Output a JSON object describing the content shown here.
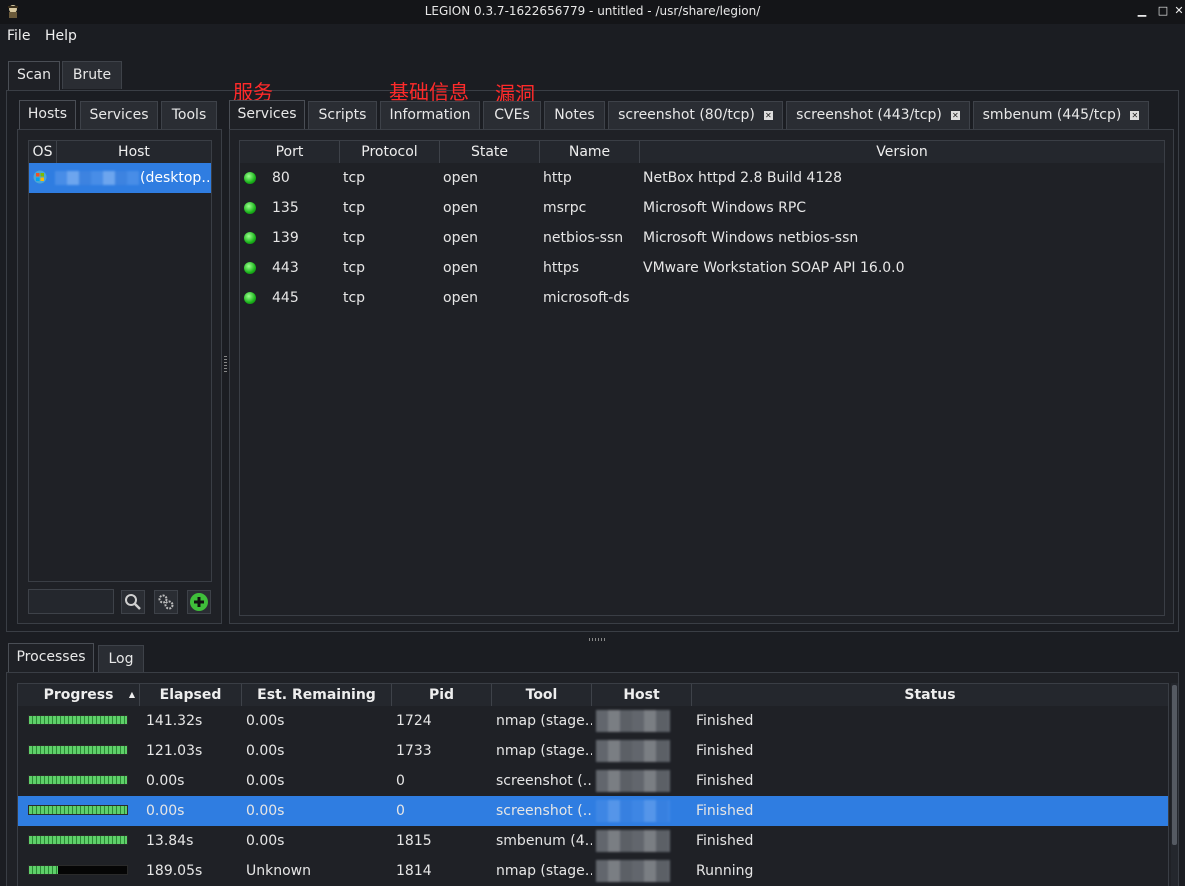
{
  "window": {
    "title": "LEGION 0.3.7-1622656779 - untitled - /usr/share/legion/"
  },
  "menu": [
    "File",
    "Help"
  ],
  "main_tabs": [
    {
      "label": "Scan",
      "active": true
    },
    {
      "label": "Brute",
      "active": false
    }
  ],
  "left_tabs": [
    {
      "label": "Hosts",
      "active": true
    },
    {
      "label": "Services",
      "active": false
    },
    {
      "label": "Tools",
      "active": false
    }
  ],
  "hosts": {
    "columns": [
      "OS",
      "Host"
    ],
    "rows": [
      {
        "os_icon": "windows-os-icon",
        "host": "(desktop…",
        "selected": true
      }
    ],
    "filter_placeholder": "",
    "buttons": {
      "search": "search-icon",
      "settings": "settings-icon",
      "add": "add-icon"
    }
  },
  "annotations": {
    "services": "服务",
    "information": "基础信息",
    "cves": "漏洞"
  },
  "right_tabs": [
    {
      "label": "Services",
      "active": true,
      "closable": false
    },
    {
      "label": "Scripts",
      "active": false,
      "closable": false
    },
    {
      "label": "Information",
      "active": false,
      "closable": false
    },
    {
      "label": "CVEs",
      "active": false,
      "closable": false
    },
    {
      "label": "Notes",
      "active": false,
      "closable": false
    },
    {
      "label": "screenshot (80/tcp)",
      "active": false,
      "closable": true
    },
    {
      "label": "screenshot (443/tcp)",
      "active": false,
      "closable": true
    },
    {
      "label": "smbenum (445/tcp)",
      "active": false,
      "closable": true
    }
  ],
  "services": {
    "columns": [
      "Port",
      "Protocol",
      "State",
      "Name",
      "Version"
    ],
    "rows": [
      {
        "port": "80",
        "protocol": "tcp",
        "state": "open",
        "name": "http",
        "version": "NetBox httpd 2.8 Build 4128"
      },
      {
        "port": "135",
        "protocol": "tcp",
        "state": "open",
        "name": "msrpc",
        "version": "Microsoft Windows RPC"
      },
      {
        "port": "139",
        "protocol": "tcp",
        "state": "open",
        "name": "netbios-ssn",
        "version": "Microsoft Windows netbios-ssn"
      },
      {
        "port": "443",
        "protocol": "tcp",
        "state": "open",
        "name": "https",
        "version": "VMware Workstation SOAP API 16.0.0"
      },
      {
        "port": "445",
        "protocol": "tcp",
        "state": "open",
        "name": "microsoft-ds",
        "version": ""
      }
    ]
  },
  "bottom_tabs": [
    {
      "label": "Processes",
      "active": true
    },
    {
      "label": "Log",
      "active": false
    }
  ],
  "processes": {
    "columns": [
      "Progress",
      "Elapsed",
      "Est. Remaining",
      "Pid",
      "Tool",
      "Host",
      "Status"
    ],
    "sort_indicator": "▲",
    "rows": [
      {
        "progress": 1.0,
        "elapsed": "141.32s",
        "remaining": "0.00s",
        "pid": "1724",
        "tool": "nmap (stage…",
        "status": "Finished",
        "selected": false
      },
      {
        "progress": 1.0,
        "elapsed": "121.03s",
        "remaining": "0.00s",
        "pid": "1733",
        "tool": "nmap (stage…",
        "status": "Finished",
        "selected": false
      },
      {
        "progress": 1.0,
        "elapsed": "0.00s",
        "remaining": "0.00s",
        "pid": "0",
        "tool": "screenshot (…",
        "status": "Finished",
        "selected": false
      },
      {
        "progress": 1.0,
        "elapsed": "0.00s",
        "remaining": "0.00s",
        "pid": "0",
        "tool": "screenshot (…",
        "status": "Finished",
        "selected": true
      },
      {
        "progress": 1.0,
        "elapsed": "13.84s",
        "remaining": "0.00s",
        "pid": "1815",
        "tool": "smbenum (4…",
        "status": "Finished",
        "selected": false
      },
      {
        "progress": 0.3,
        "elapsed": "189.05s",
        "remaining": "Unknown",
        "pid": "1814",
        "tool": "nmap (stage…",
        "status": "Running",
        "selected": false
      }
    ]
  },
  "colors": {
    "selection": "#2f7de1",
    "background": "#1f2126",
    "annotation": "#ff2a2a",
    "progress_fill": "#5fd06a"
  }
}
